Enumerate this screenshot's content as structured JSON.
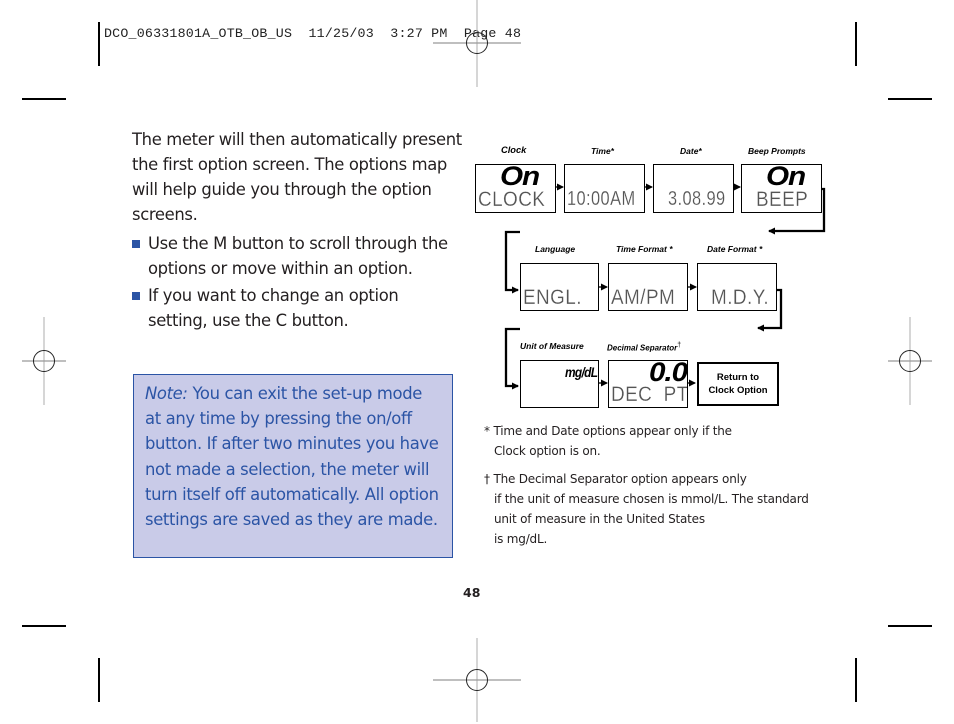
{
  "print_header": "DCO_06331801A_OTB_OB_US  11/25/03  3:27 PM  Page 48",
  "intro": {
    "paragraph": "The meter will then automatically present the first option screen. The options map will help guide you through the option screens.",
    "bullets": [
      "Use the M button to scroll through the options or move within an option.",
      "If you want to change an option setting, use the C button."
    ]
  },
  "note": {
    "label": "Note:",
    "text": " You can exit the set-up mode at any time by pressing the on/off button. If after two minutes you have not made a selection, the meter will turn itself off automatically. All option settings are saved as they are made."
  },
  "options_map": {
    "screens": [
      {
        "label": "Clock",
        "top": "On",
        "bottom": "CLOCK"
      },
      {
        "label": "Time*",
        "top": "",
        "bottom": "10:00AM"
      },
      {
        "label": "Date*",
        "top": "",
        "bottom": "3.08.99"
      },
      {
        "label": "Beep Prompts",
        "top": "On",
        "bottom": "BEEP"
      },
      {
        "label": "Language",
        "top": "",
        "bottom": "ENGL."
      },
      {
        "label": "Time Format *",
        "top": "",
        "bottom": "AM/PM"
      },
      {
        "label": "Date Format *",
        "top": "",
        "bottom": "M.D.Y."
      },
      {
        "label": "Unit of Measure",
        "top": "mg/dL",
        "bottom": ""
      },
      {
        "label": "Decimal Separator",
        "label_mark": "†",
        "top": "0.0",
        "bottom": "DEC  PT"
      }
    ],
    "return_box": {
      "line1": "Return to",
      "line2": "Clock Option"
    }
  },
  "footnotes": {
    "asterisk": {
      "mark": "*",
      "lines": [
        "Time and Date options appear only if the",
        "Clock option is on."
      ]
    },
    "dagger": {
      "mark": "†",
      "lines": [
        "The Decimal Separator option appears only",
        "if the unit of measure chosen is mmol/L. The standard",
        "unit of measure in the United States",
        "is mg/dL."
      ]
    }
  },
  "page_number": "48",
  "colors": {
    "accent_blue": "#2b54a5",
    "note_bg": "#c9cbe8"
  }
}
